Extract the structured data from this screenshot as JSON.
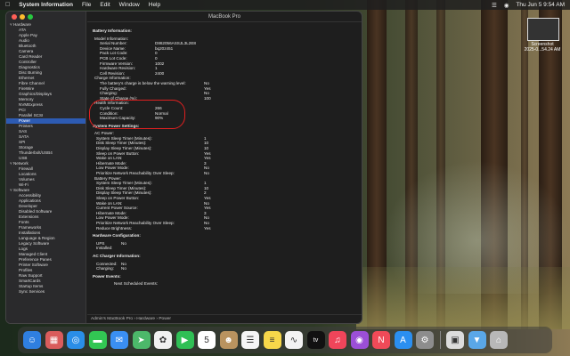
{
  "menubar": {
    "app": "System Information",
    "menus": [
      "File",
      "Edit",
      "Window",
      "Help"
    ],
    "clock": "Thu Jun 5  9:54 AM"
  },
  "window": {
    "title": "MacBook Pro",
    "path": "Admin's MacBook Pro › Hardware › Power"
  },
  "sidebar": [
    {
      "t": "cat",
      "label": "˅ Hardware"
    },
    {
      "t": "item",
      "label": "ATA"
    },
    {
      "t": "item",
      "label": "Apple Pay"
    },
    {
      "t": "item",
      "label": "Audio"
    },
    {
      "t": "item",
      "label": "Bluetooth"
    },
    {
      "t": "item",
      "label": "Camera"
    },
    {
      "t": "item",
      "label": "Card Reader"
    },
    {
      "t": "item",
      "label": "Controller"
    },
    {
      "t": "item",
      "label": "Diagnostics"
    },
    {
      "t": "item",
      "label": "Disc Burning"
    },
    {
      "t": "item",
      "label": "Ethernet"
    },
    {
      "t": "item",
      "label": "Fibre Channel"
    },
    {
      "t": "item",
      "label": "FireWire"
    },
    {
      "t": "item",
      "label": "Graphics/Displays"
    },
    {
      "t": "item",
      "label": "Memory"
    },
    {
      "t": "item",
      "label": "NVMExpress"
    },
    {
      "t": "item",
      "label": "PCI"
    },
    {
      "t": "item",
      "label": "Parallel SCSI"
    },
    {
      "t": "item",
      "label": "Power",
      "sel": true
    },
    {
      "t": "item",
      "label": "Printers"
    },
    {
      "t": "item",
      "label": "SAS"
    },
    {
      "t": "item",
      "label": "SATA"
    },
    {
      "t": "item",
      "label": "SPI"
    },
    {
      "t": "item",
      "label": "Storage"
    },
    {
      "t": "item",
      "label": "Thunderbolt/USB4"
    },
    {
      "t": "item",
      "label": "USB"
    },
    {
      "t": "cat",
      "label": "˅ Network"
    },
    {
      "t": "item",
      "label": "Firewall"
    },
    {
      "t": "item",
      "label": "Locations"
    },
    {
      "t": "item",
      "label": "Volumes"
    },
    {
      "t": "item",
      "label": "Wi-Fi"
    },
    {
      "t": "cat",
      "label": "˅ Software"
    },
    {
      "t": "item",
      "label": "Accessibility"
    },
    {
      "t": "item",
      "label": "Applications"
    },
    {
      "t": "item",
      "label": "Developer"
    },
    {
      "t": "item",
      "label": "Disabled Software"
    },
    {
      "t": "item",
      "label": "Extensions"
    },
    {
      "t": "item",
      "label": "Fonts"
    },
    {
      "t": "item",
      "label": "Frameworks"
    },
    {
      "t": "item",
      "label": "Installations"
    },
    {
      "t": "item",
      "label": "Language & Region"
    },
    {
      "t": "item",
      "label": "Legacy Software"
    },
    {
      "t": "item",
      "label": "Logs"
    },
    {
      "t": "item",
      "label": "Managed Client"
    },
    {
      "t": "item",
      "label": "Preference Panes"
    },
    {
      "t": "item",
      "label": "Printer Software"
    },
    {
      "t": "item",
      "label": "Profiles"
    },
    {
      "t": "item",
      "label": "Raw Support"
    },
    {
      "t": "item",
      "label": "SmartCards"
    },
    {
      "t": "item",
      "label": "Startup Items"
    },
    {
      "t": "item",
      "label": "Sync Services"
    }
  ],
  "report": [
    {
      "t": "sec",
      "text": "Battery Information:"
    },
    {
      "t": "sub",
      "text": "Model Information:"
    },
    {
      "t": "kv2",
      "k": "Serial Number:",
      "v": "D862056ASSJL3L2E8"
    },
    {
      "t": "kv2",
      "k": "Device Name:",
      "v": "bq20z451"
    },
    {
      "t": "kv2",
      "k": "Pack Lot Code:",
      "v": "0"
    },
    {
      "t": "kv2",
      "k": "PCB Lot Code:",
      "v": "0"
    },
    {
      "t": "kv2",
      "k": "Firmware Version:",
      "v": "1002"
    },
    {
      "t": "kv2",
      "k": "Hardware Revision:",
      "v": "1"
    },
    {
      "t": "kv2",
      "k": "Cell Revision:",
      "v": "2400"
    },
    {
      "t": "sub",
      "text": "Charge Information:"
    },
    {
      "t": "kv2w",
      "k": "The battery's charge is below the warning level:",
      "v": "No"
    },
    {
      "t": "kv2w",
      "k": "Fully Charged:",
      "v": "Yes"
    },
    {
      "t": "kv2w",
      "k": "Charging:",
      "v": "No"
    },
    {
      "t": "kv2w",
      "k": "State of Charge (%):",
      "v": "100"
    },
    {
      "t": "sub",
      "text": "Health Information:"
    },
    {
      "t": "kv2",
      "k": "Cycle Count:",
      "v": "266"
    },
    {
      "t": "kv2",
      "k": "Condition:",
      "v": "Normal"
    },
    {
      "t": "kv2",
      "k": "Maximum Capacity:",
      "v": "90%"
    },
    {
      "t": "sec",
      "text": "System Power Settings:"
    },
    {
      "t": "sub",
      "text": "AC Power:"
    },
    {
      "t": "kv1w",
      "k": "System Sleep Timer (Minutes):",
      "v": "1"
    },
    {
      "t": "kv1w",
      "k": "Disk Sleep Timer (Minutes):",
      "v": "10"
    },
    {
      "t": "kv1w",
      "k": "Display Sleep Timer (Minutes):",
      "v": "10"
    },
    {
      "t": "kv1w",
      "k": "Sleep on Power Button:",
      "v": "Yes"
    },
    {
      "t": "kv1w",
      "k": "Wake on LAN:",
      "v": "Yes"
    },
    {
      "t": "kv1w",
      "k": "Hibernate Mode:",
      "v": "3"
    },
    {
      "t": "kv1w",
      "k": "Low Power Mode:",
      "v": "No"
    },
    {
      "t": "kv1w",
      "k": "Prioritize Network Reachability Over Sleep:",
      "v": "No"
    },
    {
      "t": "sub",
      "text": "Battery Power:"
    },
    {
      "t": "kv1w",
      "k": "System Sleep Timer (Minutes):",
      "v": "1"
    },
    {
      "t": "kv1w",
      "k": "Disk Sleep Timer (Minutes):",
      "v": "10"
    },
    {
      "t": "kv1w",
      "k": "Display Sleep Timer (Minutes):",
      "v": "2"
    },
    {
      "t": "kv1w",
      "k": "Sleep on Power Button:",
      "v": "Yes"
    },
    {
      "t": "kv1w",
      "k": "Wake on LAN:",
      "v": "No"
    },
    {
      "t": "kv1w",
      "k": "Current Power Source:",
      "v": "Yes"
    },
    {
      "t": "kv1w",
      "k": "Hibernate Mode:",
      "v": "3"
    },
    {
      "t": "kv1w",
      "k": "Low Power Mode:",
      "v": "No"
    },
    {
      "t": "kv1w",
      "k": "Prioritize Network Reachability Over Sleep:",
      "v": "No"
    },
    {
      "t": "kv1w",
      "k": "Reduce Brightness:",
      "v": "Yes"
    },
    {
      "t": "sec",
      "text": "Hardware Configuration:"
    },
    {
      "t": "kv1s",
      "k": "UPS Installed:",
      "v": "No"
    },
    {
      "t": "sec",
      "text": "AC Charger Information:"
    },
    {
      "t": "kv1s",
      "k": "Connected:",
      "v": "No"
    },
    {
      "t": "kv1s",
      "k": "Charging:",
      "v": "No"
    },
    {
      "t": "sec",
      "text": "Power Events:"
    },
    {
      "t": "subc",
      "text": "Next Scheduled Events:"
    }
  ],
  "screenshot_thumb": {
    "title": "Screenshot",
    "subtitle": "2025-0...54.24 AM"
  },
  "dock": [
    {
      "name": "finder-icon",
      "color": "#2f7fe0",
      "glyph": "☺"
    },
    {
      "name": "launchpad-icon",
      "color": "#d95c5c",
      "glyph": "▦"
    },
    {
      "name": "safari-icon",
      "color": "#2a8ee8",
      "glyph": "◎"
    },
    {
      "name": "messages-icon",
      "color": "#32c653",
      "glyph": "▬"
    },
    {
      "name": "mail-icon",
      "color": "#3a8ff2",
      "glyph": "✉"
    },
    {
      "name": "maps-icon",
      "color": "#4cb86a",
      "glyph": "➤"
    },
    {
      "name": "photos-icon",
      "color": "#f1f1f1",
      "glyph": "✿"
    },
    {
      "name": "facetime-icon",
      "color": "#2fbf55",
      "glyph": "▶"
    },
    {
      "name": "calendar-icon",
      "color": "#ffffff",
      "glyph": "5"
    },
    {
      "name": "contacts-icon",
      "color": "#b9935f",
      "glyph": "☻"
    },
    {
      "name": "reminders-icon",
      "color": "#f5f5f5",
      "glyph": "☰"
    },
    {
      "name": "notes-icon",
      "color": "#f7d74a",
      "glyph": "≡"
    },
    {
      "name": "freeform-icon",
      "color": "#f3f3f3",
      "glyph": "∿"
    },
    {
      "name": "tv-icon",
      "color": "#111111",
      "glyph": "tv"
    },
    {
      "name": "music-icon",
      "color": "#f0455a",
      "glyph": "♫"
    },
    {
      "name": "podcasts-icon",
      "color": "#9b4fd6",
      "glyph": "◉"
    },
    {
      "name": "news-icon",
      "color": "#f04a58",
      "glyph": "N"
    },
    {
      "name": "app-store-icon",
      "color": "#2b8ff0",
      "glyph": "A"
    },
    {
      "name": "system-settings-icon",
      "color": "#8d8d8d",
      "glyph": "⚙"
    },
    {
      "name": "separator"
    },
    {
      "name": "preview-icon",
      "color": "#dcdcdc",
      "glyph": "▣"
    },
    {
      "name": "downloads-folder-icon",
      "color": "#5aa7e8",
      "glyph": "▼"
    },
    {
      "name": "trash-icon",
      "color": "#b8b8b8",
      "glyph": "⌂"
    }
  ]
}
